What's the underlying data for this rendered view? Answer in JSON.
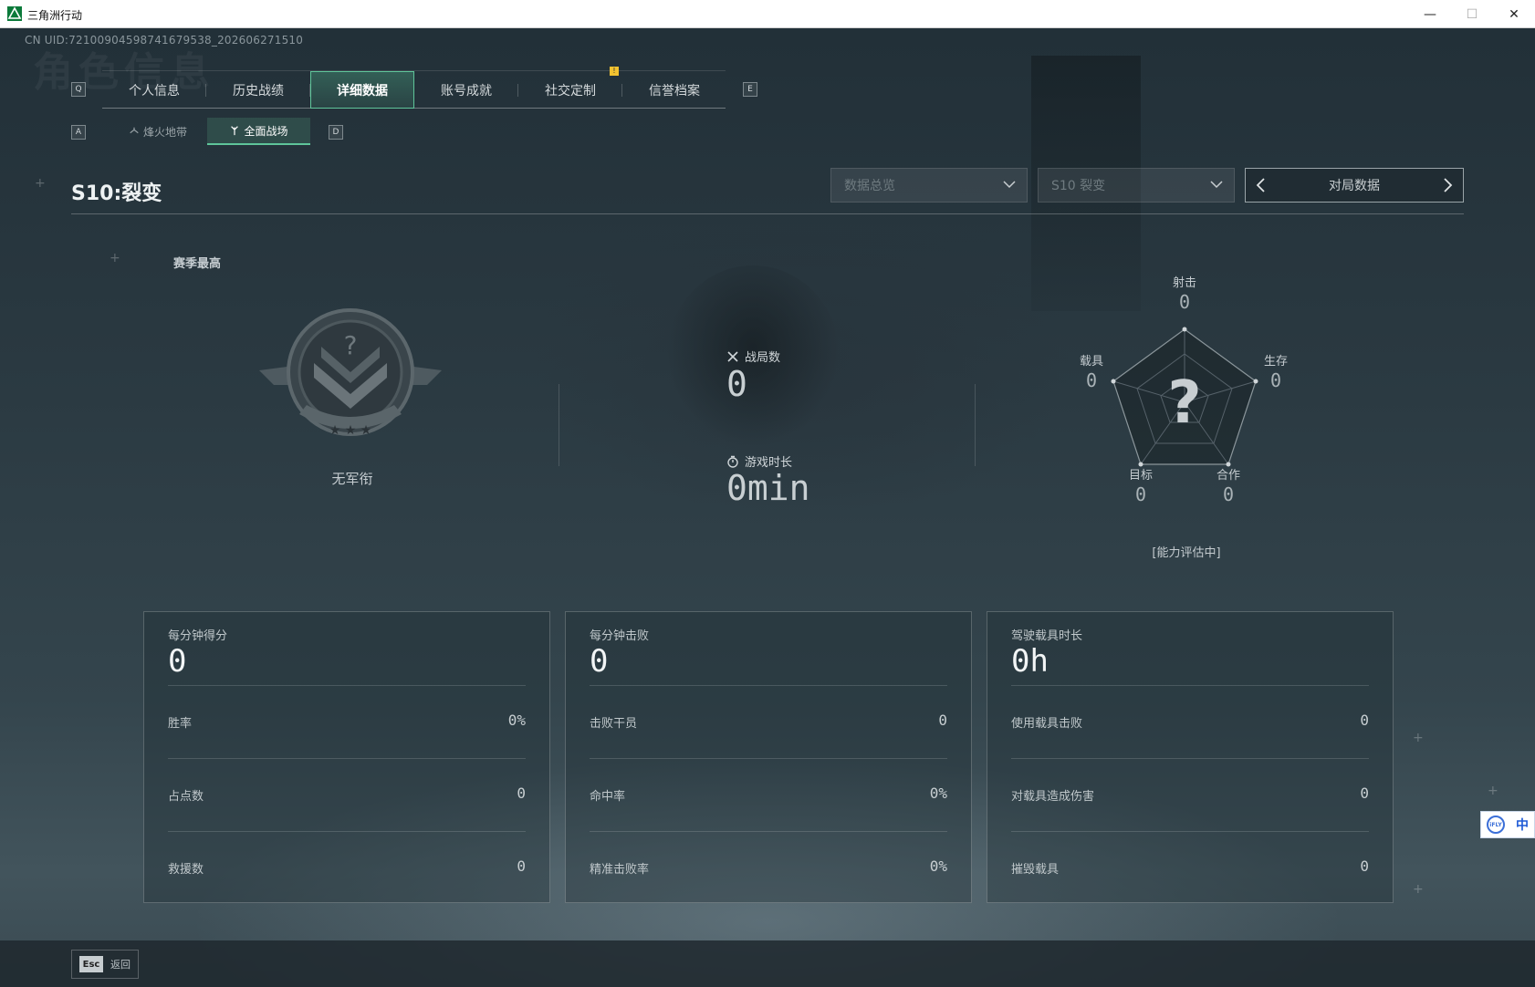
{
  "window": {
    "title": "三角洲行动",
    "minimize": "—",
    "maximize": "☐",
    "close": "✕"
  },
  "uid": "CN UID:7210090459874167953​8_202606271510",
  "ghost_title": "角色信息",
  "keys": {
    "prev_tab": "Q",
    "next_tab": "E",
    "prev_sub": "A",
    "next_sub": "D"
  },
  "tabs": [
    {
      "label": "个人信息"
    },
    {
      "label": "历史战绩"
    },
    {
      "label": "详细数据",
      "active": true
    },
    {
      "label": "账号成就"
    },
    {
      "label": "社交定制"
    },
    {
      "label": "信誉档案"
    }
  ],
  "tab_notice": "!",
  "subtabs": [
    {
      "label": "烽火地带",
      "icon": "flame-icon"
    },
    {
      "label": "全面战场",
      "icon": "battlefield-icon",
      "active": true
    }
  ],
  "season_title": "S10:裂变",
  "filters": {
    "data_dropdown": "数据总览",
    "season_dropdown": "S10 裂变",
    "pager_label": "对局数据"
  },
  "rank": {
    "section_label": "赛季最高",
    "name": "无军衔",
    "emblem_mark": "?"
  },
  "center_stats": {
    "matches_label": "战局数",
    "matches_value": "0",
    "playtime_label": "游戏时长",
    "playtime_value": "0min"
  },
  "radar": {
    "center_mark": "?",
    "axes": [
      {
        "label": "射击",
        "value": "0"
      },
      {
        "label": "生存",
        "value": "0"
      },
      {
        "label": "合作",
        "value": "0"
      },
      {
        "label": "目标",
        "value": "0"
      },
      {
        "label": "载具",
        "value": "0"
      }
    ],
    "note": "[能力评估中]"
  },
  "cards": [
    {
      "title": "每分钟得分",
      "value": "0",
      "rows": [
        {
          "label": "胜率",
          "value": "0%"
        },
        {
          "label": "占点数",
          "value": "0"
        },
        {
          "label": "救援数",
          "value": "0"
        }
      ]
    },
    {
      "title": "每分钟击败",
      "value": "0",
      "rows": [
        {
          "label": "击败干员",
          "value": "0"
        },
        {
          "label": "命中率",
          "value": "0%"
        },
        {
          "label": "精准击败率",
          "value": "0%"
        }
      ]
    },
    {
      "title": "驾驶载具时长",
      "value": "0h",
      "rows": [
        {
          "label": "使用载具击败",
          "value": "0"
        },
        {
          "label": "对载具造成伤害",
          "value": "0"
        },
        {
          "label": "摧毁载具",
          "value": "0"
        }
      ]
    }
  ],
  "footer": {
    "esc_key": "Esc",
    "back_label": "返回"
  },
  "ime": {
    "logo": "iFLY",
    "lang": "中"
  },
  "colors": {
    "accent": "#5fc59a",
    "notice": "#f2c230",
    "ime": "#1e5ad6"
  }
}
